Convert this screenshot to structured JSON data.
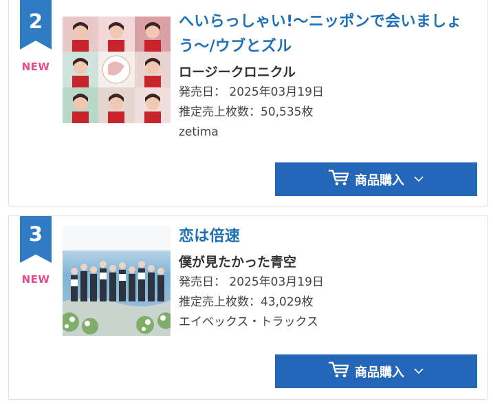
{
  "rankings": [
    {
      "rank": "2",
      "badge": "NEW",
      "title": "へいらっしゃい!〜ニッポンで会いましょう〜/ウブとズル",
      "artist": "ロージークロニクル",
      "release": "発売日： 2025年03月19日",
      "sales": "推定売上枚数：50,535枚",
      "label": "zetima",
      "buy_label": "商品購入"
    },
    {
      "rank": "3",
      "badge": "NEW",
      "title": "恋は倍速",
      "artist": "僕が見たかった青空",
      "release": "発売日： 2025年03月19日",
      "sales": "推定売上枚数：43,029枚",
      "label": "エイベックス・トラックス",
      "buy_label": "商品購入"
    }
  ],
  "colors": {
    "accent": "#2f7cc4",
    "button": "#2466b7",
    "title": "#1d6fb8",
    "new": "#e84a8a"
  },
  "icons": {
    "cart": "cart-icon",
    "chevron": "chevron-down-icon"
  }
}
